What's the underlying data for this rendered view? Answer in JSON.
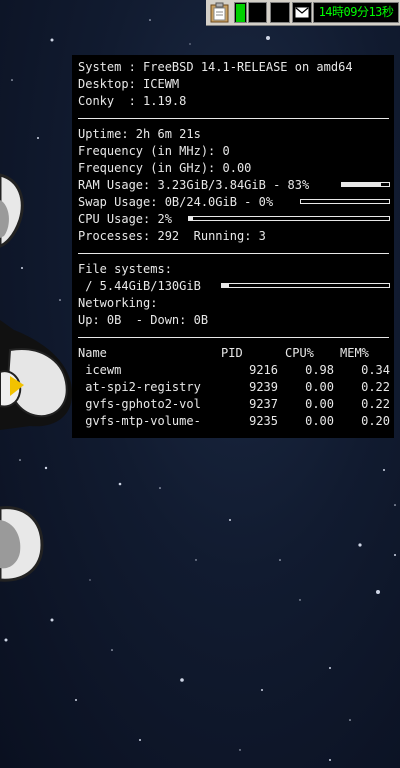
{
  "tray": {
    "clock": "14時09分13秒",
    "cpu_load_fraction": 0.95
  },
  "conky": {
    "system_label": "System : ",
    "system_value": "FreeBSD 14.1-RELEASE on amd64",
    "desktop_label": "Desktop: ",
    "desktop_value": "ICEWM",
    "conky_label": "Conky  : ",
    "conky_value": "1.19.8",
    "uptime_label": "Uptime: ",
    "uptime_value": "2h 6m 21s",
    "freq_mhz_label": "Frequency (in MHz): ",
    "freq_mhz_value": "0",
    "freq_ghz_label": "Frequency (in GHz): ",
    "freq_ghz_value": "0.00",
    "ram_label": "RAM Usage: ",
    "ram_value": "3.23GiB/3.84GiB - 83%",
    "ram_fraction": 0.83,
    "swap_label": "Swap Usage: ",
    "swap_value": "0B/24.0GiB - 0%",
    "swap_fraction": 0.0,
    "cpu_label": "CPU Usage: ",
    "cpu_value": "2%",
    "cpu_fraction": 0.02,
    "processes_label": "Processes: ",
    "processes_value": "292",
    "running_label": "  Running: ",
    "running_value": "3",
    "fs_label": "File systems:",
    "fs_value": " / 5.44GiB/130GiB",
    "fs_fraction": 0.04,
    "net_label": "Networking:",
    "up_label": "Up: ",
    "up_value": "0B",
    "down_label": "  - Down: ",
    "down_value": "0B",
    "proc_headers": [
      "Name",
      "PID",
      "CPU%",
      "MEM%"
    ],
    "processes": [
      {
        "name": " icewm",
        "pid": "9216",
        "cpu": "0.98",
        "mem": "0.34"
      },
      {
        "name": " at-spi2-registry",
        "pid": "9239",
        "cpu": "0.00",
        "mem": "0.22"
      },
      {
        "name": " gvfs-gphoto2-vol",
        "pid": "9237",
        "cpu": "0.00",
        "mem": "0.22"
      },
      {
        "name": " gvfs-mtp-volume-",
        "pid": "9235",
        "cpu": "0.00",
        "mem": "0.20"
      }
    ]
  }
}
